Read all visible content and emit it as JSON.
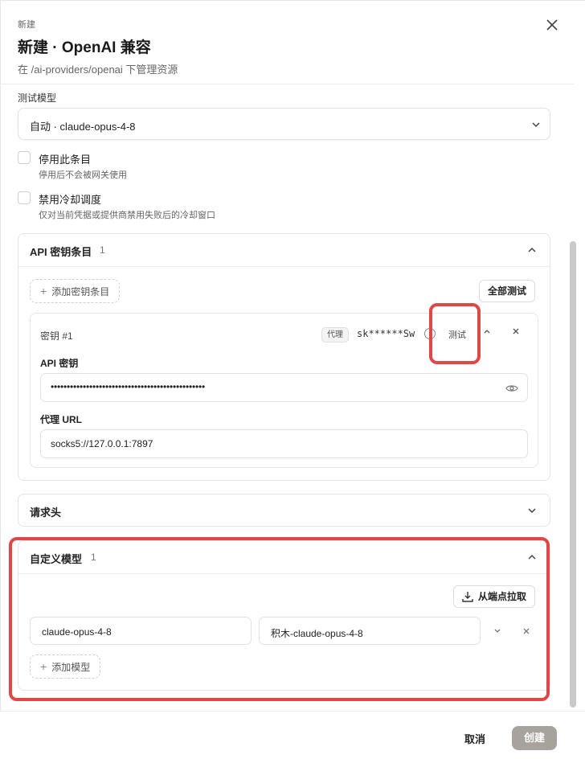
{
  "header": {
    "crumb": "新建",
    "title": "新建 · OpenAI 兼容",
    "subtitle": "在 /ai-providers/openai 下管理资源"
  },
  "test_model": {
    "label": "测试模型",
    "value": "自动 · claude-opus-4-8"
  },
  "options": [
    {
      "title": "停用此条目",
      "desc": "停用后不会被网关使用",
      "checked": false
    },
    {
      "title": "禁用冷却调度",
      "desc": "仅对当前凭据或提供商禁用失败后的冷却窗口",
      "checked": false
    }
  ],
  "api_keys": {
    "title": "API 密钥条目",
    "count": "1",
    "add_label": "添加密钥条目",
    "test_all_label": "全部测试",
    "entry": {
      "title": "密钥 #1",
      "tag": "代理",
      "masked": "sk******Sw",
      "test_label": "测试",
      "key_label": "API 密钥",
      "key_value": "••••••••••••••••••••••••••••••••••••••••••••••••",
      "proxy_label": "代理 URL",
      "proxy_value": "socks5://127.0.0.1:7897"
    }
  },
  "headers_panel": {
    "title": "请求头"
  },
  "custom_models": {
    "title": "自定义模型",
    "count": "1",
    "pull_label": "从端点拉取",
    "rows": [
      {
        "name": "claude-opus-4-8",
        "alias": "积木-claude-opus-4-8"
      }
    ],
    "add_label": "添加模型"
  },
  "footer": {
    "cancel": "取消",
    "create": "创建"
  },
  "colors": {
    "highlight": "#e04848",
    "create_button": "#a7a29c"
  }
}
